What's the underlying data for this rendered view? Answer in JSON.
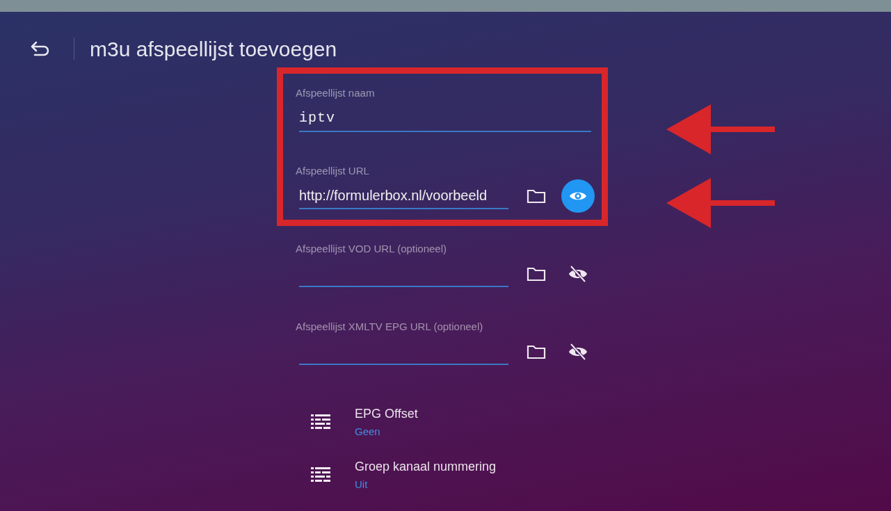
{
  "header": {
    "title": "m3u afspeellijst toevoegen"
  },
  "fields": [
    {
      "kind": "text",
      "label": "Afspeellijst naam",
      "value": "iptv"
    },
    {
      "kind": "url",
      "label": "Afspeellijst URL",
      "value": "http://formulerbox.nl/voorbeeld",
      "visible": true,
      "focused": true
    },
    {
      "kind": "url",
      "label": "Afspeellijst VOD URL (optioneel)",
      "visible": false,
      "focused": false
    },
    {
      "kind": "url",
      "label": "Afspeellijst XMLTV EPG URL (optioneel)",
      "visible": false,
      "focused": false
    }
  ],
  "settings": [
    {
      "title": "EPG Offset",
      "value": "Geen"
    },
    {
      "title": "Groep kanaal nummering",
      "value": "Uit"
    }
  ],
  "annotations": [
    {
      "kind": "box"
    },
    {
      "kind": "arrow"
    },
    {
      "kind": "arrow"
    }
  ]
}
